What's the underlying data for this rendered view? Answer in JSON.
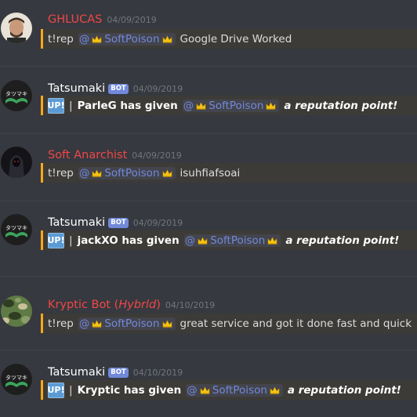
{
  "messages": [
    {
      "author": "GHLUCAS",
      "author_color": "#f04747",
      "timestamp": "04/09/2019",
      "command": "t!rep",
      "mention_name": "SoftPoison",
      "text": "Google Drive Worked"
    },
    {
      "author": "Tatsumaki",
      "author_color": "#ffffff",
      "bot_tag": "BOT",
      "timestamp": "04/09/2019",
      "badge": "UP!",
      "sep": "|",
      "lead": "ParleG has given",
      "mention_name": "SoftPoison",
      "tail": "a reputation point!"
    },
    {
      "author": "Soft Anarchist",
      "author_color": "#f04747",
      "timestamp": "04/09/2019",
      "command": "t!rep",
      "mention_name": "SoftPoison",
      "text": "isuhfiafsoai"
    },
    {
      "author": "Tatsumaki",
      "author_color": "#ffffff",
      "bot_tag": "BOT",
      "timestamp": "04/09/2019",
      "badge": "UP!",
      "sep": "|",
      "lead": "jackXO has given",
      "mention_name": "SoftPoison",
      "tail": "a reputation point!"
    },
    {
      "author": "Kryptic Bot",
      "author_suffix_open": "(",
      "author_suffix": "Hybrld",
      "author_suffix_close": ")",
      "author_color": "#f04747",
      "timestamp": "04/10/2019",
      "command": "t!rep",
      "mention_name": "SoftPoison",
      "text": "great service and got it done fast and quick"
    },
    {
      "author": "Tatsumaki",
      "author_color": "#ffffff",
      "bot_tag": "BOT",
      "timestamp": "04/10/2019",
      "badge": "UP!",
      "sep": "|",
      "lead": "Kryptic has given",
      "mention_name": "SoftPoison",
      "tail": "a reputation point!"
    }
  ],
  "mention_prefix": "@",
  "colors": {
    "background": "#36393f",
    "mention": "#7289da",
    "highlight_border": "#faa61a",
    "highlight_bg": "#3d3b38",
    "bot_tag": "#7289da",
    "timestamp": "#72767d"
  },
  "icons": {
    "crown": "crown-emoji-icon",
    "ghlucas_avatar": "person-photo-avatar",
    "tatsumaki_avatar": "tatsumaki-logo-avatar",
    "anarchist_avatar": "hooded-figure-avatar",
    "kryptic_avatar": "camo-pattern-avatar"
  }
}
